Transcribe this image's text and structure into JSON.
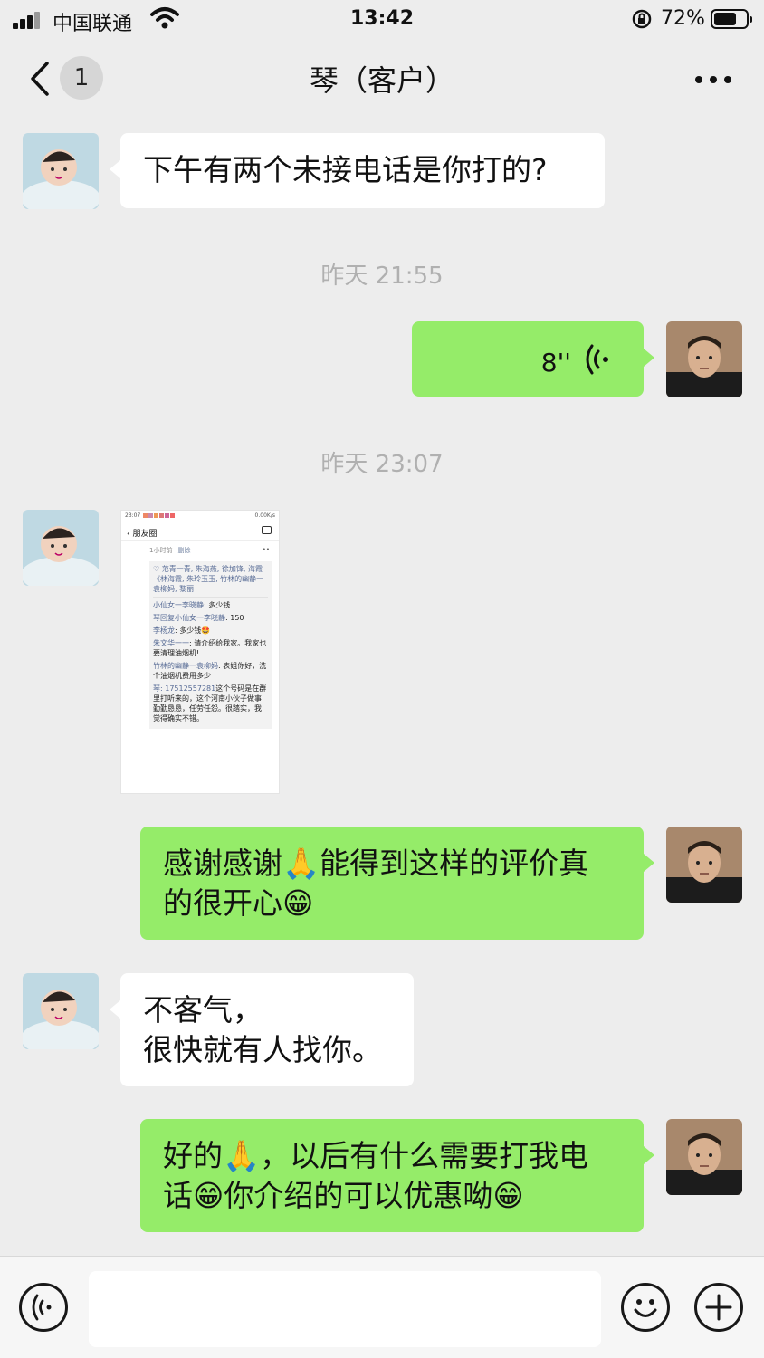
{
  "status": {
    "carrier": "中国联通",
    "time": "13:42",
    "battery_pct": "72%",
    "battery_level": 0.72
  },
  "nav": {
    "back_badge": "1",
    "title": "琴（客户）"
  },
  "messages": [
    {
      "side": "left",
      "type": "text",
      "text": "下午有两个未接电话是你打的?"
    },
    {
      "type": "timestamp",
      "text": "昨天 21:55"
    },
    {
      "side": "right",
      "type": "voice",
      "duration": "8''"
    },
    {
      "type": "timestamp",
      "text": "昨天 23:07"
    },
    {
      "side": "left",
      "type": "image"
    },
    {
      "side": "right",
      "type": "text",
      "text": "感谢感谢🙏能得到这样的评价真\n的很开心😁"
    },
    {
      "side": "left",
      "type": "text",
      "text": "不客气，\n很快就有人找你。"
    },
    {
      "side": "right",
      "type": "text",
      "text": "好的🙏，以后有什么需要打我电\n话😁你介绍的可以优惠呦😁"
    }
  ],
  "shared_image": {
    "status_time": "23:07",
    "status_right": "0.00K/s",
    "header": "朋友圈",
    "meta_time": "1小时前",
    "meta_delete": "删除",
    "meta_options": "••",
    "likes": "♡ 范青一青, 朱海燕, 徐加锋, 海霞《林海霞, 朱玲玉玉, 竹林的幽静一袁柳妈, 黎丽",
    "comments": [
      {
        "name": "小仙女一李晓静",
        "text": ": 多少钱"
      },
      {
        "name": "琴回复小仙女一李晓静",
        "text": ": 150"
      },
      {
        "name": "李杨龙",
        "text": ": 多少钱🤩"
      },
      {
        "name": "朱文华一一",
        "text": ": 请介绍给我家。我家也要清理油烟机!"
      },
      {
        "name": "竹林的幽静一袁柳妈",
        "text": ": 表姐你好，洗个油烟机费用多少"
      },
      {
        "name": "琴: 17512557281",
        "text": "这个号码是在群里打听来的，这个河南小伙子做事勤勤恳恳，任劳任怨。很踏实，我觉得确实不错。"
      }
    ]
  },
  "colors": {
    "background": "#ededed",
    "bubble_self": "#95ec69",
    "bubble_other": "#ffffff",
    "timestamp": "#b0b0b0",
    "link": "#576b95"
  },
  "icons": {
    "voice_toggle": "voice-icon",
    "emoji": "emoji-icon",
    "plus": "plus-icon",
    "more": "more-icon"
  }
}
